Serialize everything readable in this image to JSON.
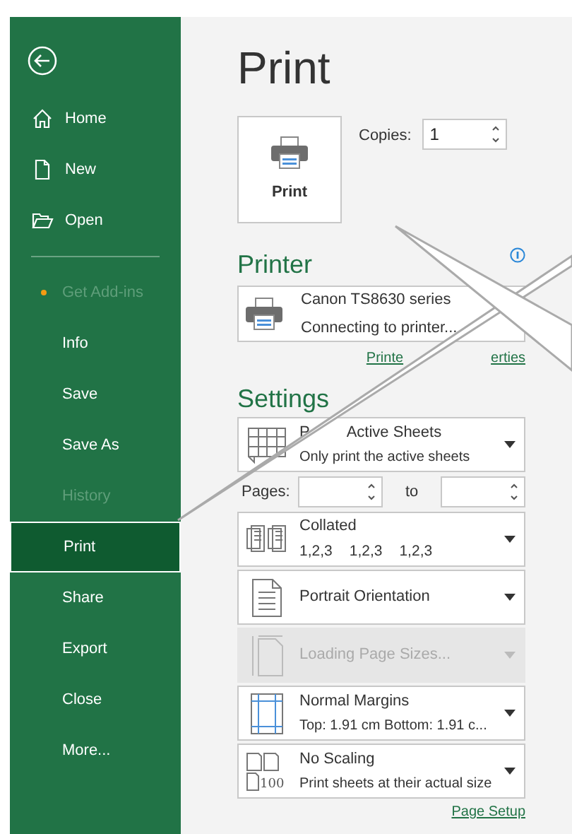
{
  "sidebar": {
    "top_items": [
      {
        "label": "Home",
        "kind": "home"
      },
      {
        "label": "New",
        "kind": "new"
      },
      {
        "label": "Open",
        "kind": "open"
      }
    ],
    "items": [
      {
        "label": "Get Add-ins",
        "disabled": true,
        "notification": true,
        "selected": false
      },
      {
        "label": "Info",
        "disabled": false,
        "notification": false,
        "selected": false
      },
      {
        "label": "Save",
        "disabled": false,
        "notification": false,
        "selected": false
      },
      {
        "label": "Save As",
        "disabled": false,
        "notification": false,
        "selected": false
      },
      {
        "label": "History",
        "disabled": true,
        "notification": false,
        "selected": false
      },
      {
        "label": "Print",
        "disabled": false,
        "notification": false,
        "selected": true
      },
      {
        "label": "Share",
        "disabled": false,
        "notification": false,
        "selected": false
      },
      {
        "label": "Export",
        "disabled": false,
        "notification": false,
        "selected": false
      },
      {
        "label": "Close",
        "disabled": false,
        "notification": false,
        "selected": false
      },
      {
        "label": "More...",
        "disabled": false,
        "notification": false,
        "selected": false
      }
    ]
  },
  "title": "Print",
  "print_button": "Print",
  "copies": {
    "label": "Copies:",
    "value": "1"
  },
  "printer": {
    "heading": "Printer",
    "name": "Canon TS8630 series",
    "status": "Connecting to printer...",
    "link_parts": [
      "Printe",
      "erties"
    ]
  },
  "settings": {
    "heading": "Settings",
    "dropdowns": [
      {
        "kind": "sheets",
        "title_parts": [
          "P",
          "Active Sheets"
        ],
        "subtitle": "Only print the active sheets",
        "disabled": false
      },
      {
        "kind": "pages",
        "label": "Pages:",
        "to": "to"
      },
      {
        "kind": "collated",
        "title": "Collated",
        "subtitle_parts": [
          "1,2,3",
          "1,2,3",
          "1,2,3"
        ],
        "disabled": false
      },
      {
        "kind": "orientation",
        "title": "Portrait Orientation",
        "disabled": false
      },
      {
        "kind": "page-size",
        "title": "Loading Page Sizes...",
        "disabled": true
      },
      {
        "kind": "margins",
        "title": "Normal Margins",
        "subtitle": "Top: 1.91 cm Bottom: 1.91 c...",
        "disabled": false
      },
      {
        "kind": "scaling",
        "title": "No Scaling",
        "subtitle": "Print sheets at their actual size",
        "badge": "100",
        "disabled": false
      }
    ],
    "link": "Page Setup"
  }
}
